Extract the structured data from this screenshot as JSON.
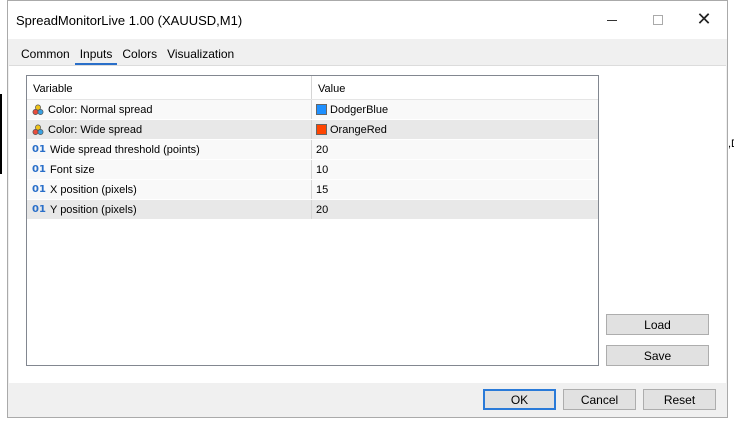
{
  "window": {
    "title": "SpreadMonitorLive 1.00 (XAUUSD,M1)",
    "minimize_icon": "minimize-icon",
    "maximize_icon": "maximize-icon",
    "close_icon": "close-icon"
  },
  "background": {
    "fragment_text": ",D"
  },
  "tabs": [
    {
      "label": "Common",
      "active": false
    },
    {
      "label": "Inputs",
      "active": true
    },
    {
      "label": "Colors",
      "active": false
    },
    {
      "label": "Visualization",
      "active": false
    }
  ],
  "grid": {
    "columns": [
      "Variable",
      "Value"
    ],
    "rows": [
      {
        "icon": "color-palette-icon",
        "variable": "Color: Normal spread",
        "value": "DodgerBlue",
        "swatch": "#1e90ff"
      },
      {
        "icon": "color-palette-icon",
        "variable": "Color: Wide spread",
        "value": "OrangeRed",
        "swatch": "#ff4500"
      },
      {
        "icon": "numeric-icon",
        "icon_text": "01",
        "variable": "Wide spread threshold (points)",
        "value": "20"
      },
      {
        "icon": "numeric-icon",
        "icon_text": "01",
        "variable": "Font size",
        "value": "10"
      },
      {
        "icon": "numeric-icon",
        "icon_text": "01",
        "variable": "X position (pixels)",
        "value": "15"
      },
      {
        "icon": "numeric-icon",
        "icon_text": "01",
        "variable": "Y position (pixels)",
        "value": "20"
      }
    ]
  },
  "buttons": {
    "load": "Load",
    "save": "Save",
    "ok": "OK",
    "cancel": "Cancel",
    "reset": "Reset"
  },
  "colors": {
    "accent": "#2a7ad8",
    "normal_spread": "#1e90ff",
    "wide_spread": "#ff4500"
  }
}
